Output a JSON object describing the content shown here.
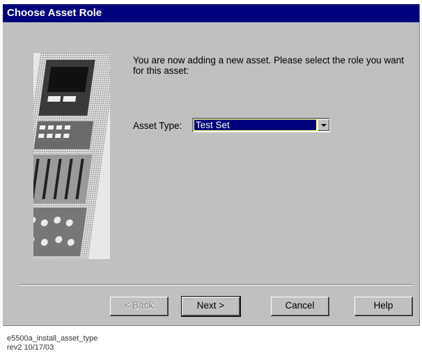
{
  "dialog": {
    "title": "Choose Asset Role",
    "prompt": "You are now adding a new asset.  Please select the role you want for this asset:",
    "asset_type_label": "Asset Type:",
    "asset_type_value": "Test Set"
  },
  "buttons": {
    "back_label": "< Back",
    "next_label": "Next >",
    "cancel_label": "Cancel",
    "help_label": "Help"
  },
  "footer": {
    "line1": "e5500a_install_asset_type",
    "line2": "rev2 10/17/03"
  }
}
